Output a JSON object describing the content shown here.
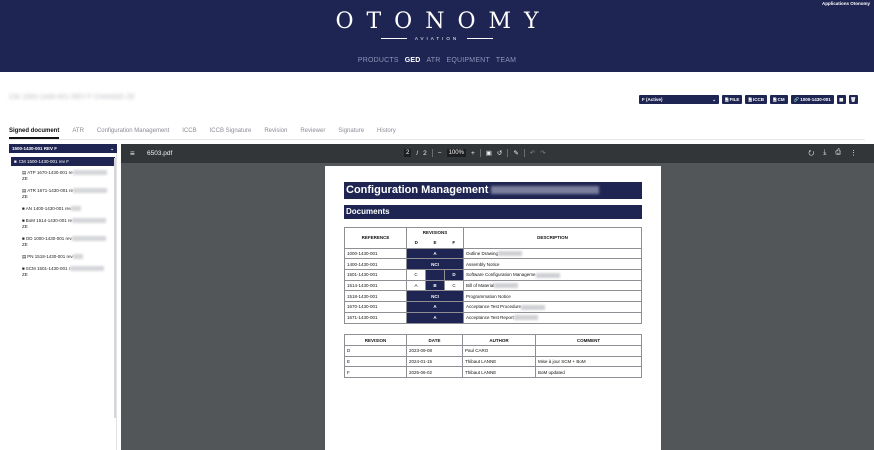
{
  "header": {
    "corner_label": "Applications Otonomy",
    "logo_main": "OTONOMY",
    "logo_sub": "AVIATION",
    "nav": [
      {
        "label": "PRODUCTS",
        "active": false
      },
      {
        "label": "GED",
        "active": true
      },
      {
        "label": "ATR",
        "active": false
      },
      {
        "label": "EQUIPMENT",
        "active": false
      },
      {
        "label": "TEAM",
        "active": false
      }
    ]
  },
  "document": {
    "title": "CM 1500-1430-001 REV F CHANGE-ZE"
  },
  "toolbar": {
    "status_value": "F (Active)",
    "file_label": "FILE",
    "iccb_label": "ICCB",
    "cm_label": "CM",
    "link_label": "1000-1430-001",
    "colors": {
      "navy": "#1e2552"
    }
  },
  "tabs": [
    {
      "label": "Signed document",
      "active": true
    },
    {
      "label": "ATR",
      "active": false
    },
    {
      "label": "Configuration Management",
      "active": false
    },
    {
      "label": "ICCB",
      "active": false
    },
    {
      "label": "ICCB Signature",
      "active": false
    },
    {
      "label": "Revision",
      "active": false
    },
    {
      "label": "Reviewer",
      "active": false
    },
    {
      "label": "Signature",
      "active": false
    },
    {
      "label": "History",
      "active": false
    }
  ],
  "tree": {
    "root": "1500-1430-001 REV F",
    "selected": "CM 1500-1430-001 rev F",
    "items": [
      {
        "icon": "file-icon",
        "label": "ATP 1670-1430-001 re",
        "suffix": "ZE"
      },
      {
        "icon": "file-icon",
        "label": "ATR 1671-1430-001 re",
        "suffix": "ZE"
      },
      {
        "icon": "folder-icon",
        "label": "AN 1400-1430-001 rev",
        "suffix": ""
      },
      {
        "icon": "folder-icon",
        "label": "BoM 1514-1430-001 re",
        "suffix": "ZE"
      },
      {
        "icon": "folder-icon",
        "label": "OD 1000-1430-001 rev",
        "suffix": "ZE"
      },
      {
        "icon": "file-icon",
        "label": "PN 1518-1430-001 rev",
        "suffix": ""
      },
      {
        "icon": "folder-icon",
        "label": "SCM 1501-1430-001 r",
        "suffix": "ZE"
      }
    ]
  },
  "viewer": {
    "filename": "6503.pdf",
    "page_current": "2",
    "page_total": "2",
    "zoom": "100%",
    "colors": {
      "bar": "#323639",
      "background": "#525659"
    }
  },
  "pdf": {
    "title": "Configuration Management",
    "section": "Documents",
    "revisions": {
      "col_reference": "REFERENCE",
      "col_revisions": "REVISIONS",
      "col_description": "DESCRIPTION",
      "letters": [
        "D",
        "E",
        "F"
      ],
      "rows": [
        {
          "ref": "1000-1430-001",
          "cells": [
            "A"
          ],
          "span": true,
          "desc": "Outline Drawing"
        },
        {
          "ref": "1400-1430-001",
          "cells": [
            "NCI"
          ],
          "span": true,
          "desc": "Assembly Notice"
        },
        {
          "ref": "1501-1430-001",
          "cells": [
            "C",
            "",
            "D"
          ],
          "span": false,
          "dark": [
            false,
            true,
            true
          ],
          "desc": "Software Configuration Manageme"
        },
        {
          "ref": "1514-1430-001",
          "cells": [
            "A",
            "B",
            "C"
          ],
          "span": false,
          "dark": [
            false,
            true,
            false
          ],
          "desc": "Bill of Material"
        },
        {
          "ref": "1518-1430-001",
          "cells": [
            "NCI"
          ],
          "span": true,
          "desc": "Programmation Notice"
        },
        {
          "ref": "1670-1430-001",
          "cells": [
            "A"
          ],
          "span": true,
          "desc": "Acceptance Test Procedure"
        },
        {
          "ref": "1671-1430-001",
          "cells": [
            "A"
          ],
          "span": true,
          "desc": "Acceptance Test Report"
        }
      ]
    },
    "history": {
      "col_revision": "REVISION",
      "col_date": "DATE",
      "col_author": "AUTHOR",
      "col_comment": "COMMENT",
      "rows": [
        {
          "revision": "D",
          "date": "2023-09-08",
          "author": "Paul CARO",
          "comment": ""
        },
        {
          "revision": "E",
          "date": "2024-01-15",
          "author": "Thibaut LANNE",
          "comment": "Mise à jour SCM + BoM"
        },
        {
          "revision": "F",
          "date": "2025-06-02",
          "author": "Thibaut LANNE",
          "comment": "BoM updated"
        }
      ]
    }
  }
}
